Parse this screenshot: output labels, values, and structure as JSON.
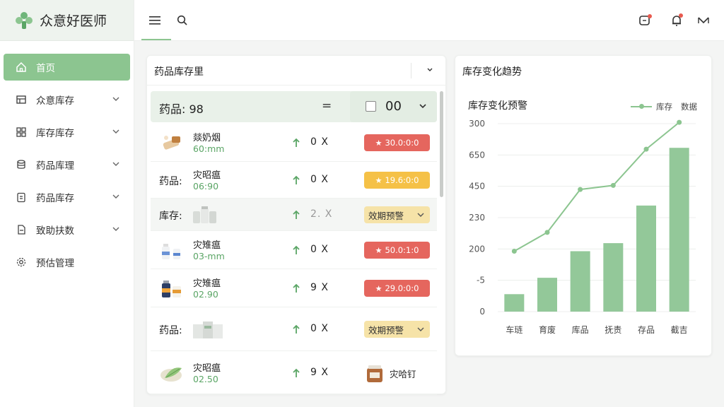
{
  "brand": {
    "name": "众意好医师"
  },
  "sidebar": {
    "items": [
      {
        "label": "首页",
        "icon": "home-icon",
        "active": true,
        "chevron": false
      },
      {
        "label": "众意库存",
        "icon": "table-icon",
        "chevron": true
      },
      {
        "label": "库存库存",
        "icon": "grid-icon",
        "chevron": true
      },
      {
        "label": "药品库理",
        "icon": "database-icon",
        "chevron": true
      },
      {
        "label": "药品库存",
        "icon": "clipboard-icon",
        "chevron": true
      },
      {
        "label": "致助扶数",
        "icon": "document-icon",
        "chevron": true
      },
      {
        "label": "预估管理",
        "icon": "gear-icon",
        "chevron": false
      }
    ]
  },
  "inventory": {
    "title": "药品库存里",
    "summary": {
      "label": "药品: 98",
      "eq": "=",
      "select_value": "00"
    },
    "rows": [
      {
        "prefix": "",
        "name": "燚奶烟",
        "sub": "60:mm",
        "qty": "0 X",
        "qty_muted": false,
        "badge": {
          "type": "red",
          "text": "30.0:0:0"
        },
        "thumb": "pills"
      },
      {
        "prefix": "药品:",
        "name": "灾昭瘟",
        "sub": "06:90",
        "qty": "0 X",
        "qty_muted": false,
        "badge": {
          "type": "yellow",
          "text": "19.6:0:0"
        },
        "thumb": ""
      },
      {
        "prefix": "库存:",
        "name": "",
        "sub": "",
        "qty": "2. X",
        "qty_muted": true,
        "badge": {
          "type": "warn",
          "text": "效期预警"
        },
        "thumb": "bottles"
      },
      {
        "prefix": "",
        "name": "灾雉瘟",
        "sub": "03-mm",
        "qty": "0 X",
        "qty_muted": false,
        "badge": {
          "type": "red",
          "text": "50.0:1:0"
        },
        "thumb": "bottles-blue"
      },
      {
        "prefix": "",
        "name": "灾雉瘟",
        "sub": "02.90",
        "qty": "9 X",
        "qty_muted": false,
        "badge": {
          "type": "red",
          "text": "29.0:0:0"
        },
        "thumb": "bottles-orange"
      },
      {
        "prefix": "药品:",
        "name": "",
        "sub": "",
        "qty": "0 X",
        "qty_muted": false,
        "badge": {
          "type": "warn",
          "text": "效期预警"
        },
        "thumb": "boxes"
      },
      {
        "prefix": "",
        "name": "灾昭瘟",
        "sub": "02.50",
        "qty": "9 X",
        "qty_muted": false,
        "badge": {
          "type": "item",
          "text": "灾哈钉"
        },
        "thumb": "leaf"
      }
    ]
  },
  "trend": {
    "panel_title": "库存变化趋势",
    "chart_title": "库存变化预警",
    "legend_label": "库存",
    "legend_extra": "数据"
  },
  "chart_data": {
    "type": "bar",
    "categories": [
      "车琏",
      "育废",
      "库品",
      "抚责",
      "存品",
      "截吉"
    ],
    "y_tick_labels": [
      "300",
      "650",
      "450",
      "230",
      "200",
      "-5",
      "0"
    ],
    "series": [
      {
        "type": "bar",
        "values": [
          65,
          126,
          225,
          255,
          395,
          610
        ]
      },
      {
        "name": "库存",
        "type": "line",
        "values": [
          225,
          295,
          455,
          470,
          605,
          705
        ]
      }
    ],
    "ylim": [
      0,
      700
    ],
    "grid": true,
    "legend_position": "top-right",
    "colors": {
      "bar": "#93c899",
      "line": "#8cc590"
    }
  },
  "colors": {
    "accent": "#8cc590",
    "danger": "#e5665e",
    "warning": "#f5c147",
    "warn_bg": "#f6e3a8"
  }
}
